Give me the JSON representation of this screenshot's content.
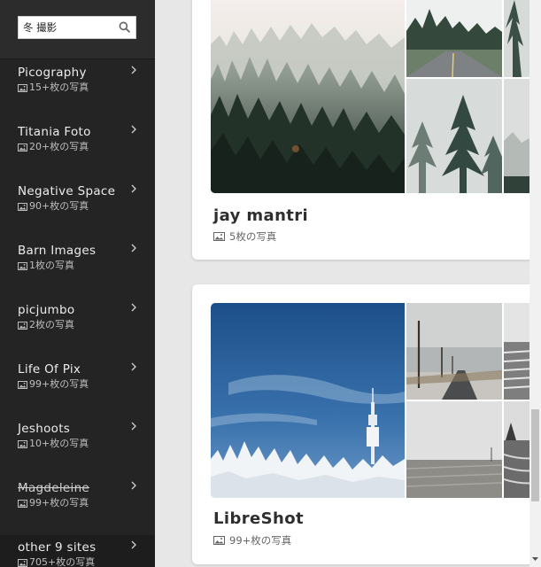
{
  "search": {
    "value": "冬 撮影"
  },
  "sidebar": {
    "items": [
      {
        "name": "Picography",
        "count": "15+枚の写真",
        "struck": false
      },
      {
        "name": "Titania Foto",
        "count": "20+枚の写真",
        "struck": false
      },
      {
        "name": "Negative Space",
        "count": "90+枚の写真",
        "struck": false
      },
      {
        "name": "Barn Images",
        "count": "1枚の写真",
        "struck": false
      },
      {
        "name": "picjumbo",
        "count": "2枚の写真",
        "struck": false
      },
      {
        "name": "Life Of Pix",
        "count": "99+枚の写真",
        "struck": false
      },
      {
        "name": "Jeshoots",
        "count": "10+枚の写真",
        "struck": false
      },
      {
        "name": "Magdeleine",
        "count": "99+枚の写真",
        "struck": true
      },
      {
        "name": "other 9 sites",
        "count": "705+枚の写真",
        "struck": false
      }
    ]
  },
  "results": [
    {
      "title": "jay mantri",
      "count": "5枚の写真"
    },
    {
      "title": "LibreShot",
      "count": "99+枚の写真"
    }
  ],
  "colors": {
    "sidebar_bg": "#242424",
    "main_bg": "#e7e7e7",
    "card_bg": "#ffffff"
  }
}
